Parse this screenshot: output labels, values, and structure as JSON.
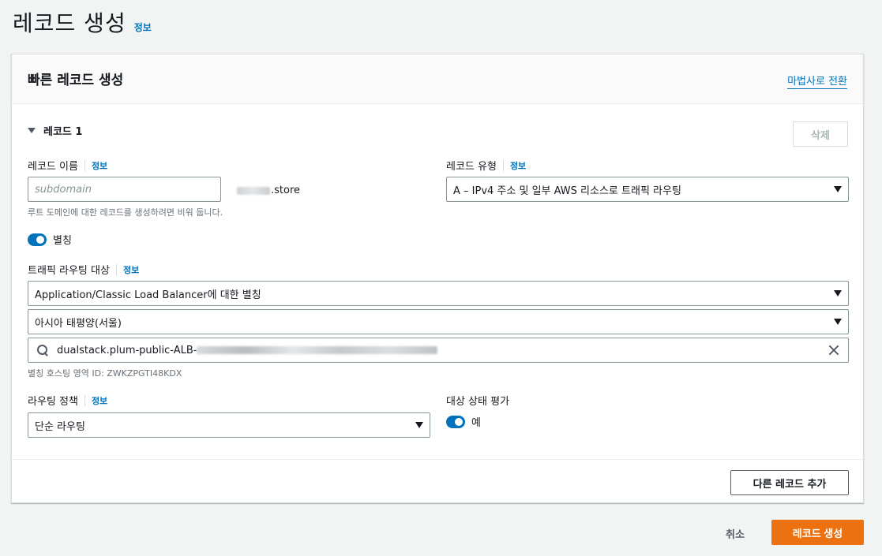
{
  "header": {
    "title": "레코드 생성",
    "info": "정보"
  },
  "card": {
    "title": "빠른 레코드 생성",
    "wizard_link": "마법사로 전환"
  },
  "record": {
    "label": "레코드 1",
    "delete_label": "삭제"
  },
  "record_name": {
    "label": "레코드 이름",
    "info": "정보",
    "placeholder": "subdomain",
    "domain_suffix": ".store",
    "hint": "루트 도메인에 대한 레코드를 생성하려면 비워 둡니다."
  },
  "record_type": {
    "label": "레코드 유형",
    "info": "정보",
    "value": "A – IPv4 주소 및 일부 AWS 리소스로 트래픽 라우팅"
  },
  "alias": {
    "label": "별칭",
    "enabled": true
  },
  "route_target": {
    "label": "트래픽 라우팅 대상",
    "info": "정보",
    "endpoint_type": "Application/Classic Load Balancer에 대한 별칭",
    "region": "아시아 태평양(서울)",
    "search_value": "dualstack.plum-public-ALB-",
    "hosted_zone": "별칭 호스팅 영역 ID: ZWKZPGTI48KDX"
  },
  "routing_policy": {
    "label": "라우팅 정책",
    "info": "정보",
    "value": "단순 라우팅"
  },
  "health": {
    "label": "대상 상태 평가",
    "toggle_label": "예",
    "enabled": true
  },
  "actions": {
    "add_record": "다른 레코드 추가",
    "cancel": "취소",
    "create": "레코드 생성"
  }
}
